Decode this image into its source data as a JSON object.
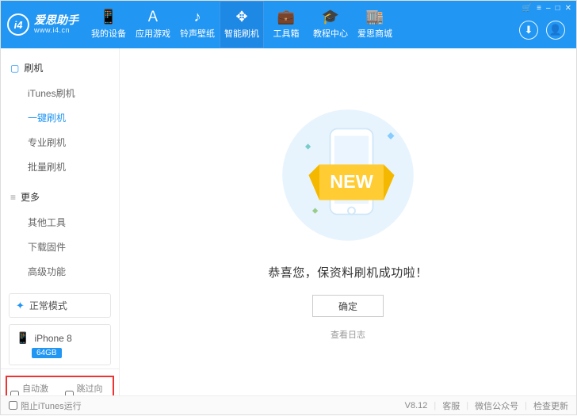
{
  "brand": {
    "logo": "i4",
    "title": "爱思助手",
    "subtitle": "www.i4.cn"
  },
  "titlebar": {
    "btn_cart": "🛒",
    "btn_menu": "≡",
    "btn_min": "–",
    "btn_max": "□",
    "btn_close": "✕"
  },
  "nav": [
    {
      "icon": "📱",
      "label": "我的设备"
    },
    {
      "icon": "Ａ",
      "label": "应用游戏"
    },
    {
      "icon": "♪",
      "label": "铃声壁纸"
    },
    {
      "icon": "✥",
      "label": "智能刷机",
      "active": true
    },
    {
      "icon": "💼",
      "label": "工具箱"
    },
    {
      "icon": "🎓",
      "label": "教程中心"
    },
    {
      "icon": "🏬",
      "label": "爱思商城"
    }
  ],
  "topright": {
    "download_icon": "⬇",
    "user_icon": "👤"
  },
  "sidebar": {
    "sections": [
      {
        "key": "flash",
        "icon": "▢",
        "title": "刷机",
        "items": [
          {
            "label": "iTunes刷机"
          },
          {
            "label": "一键刷机",
            "active": true
          },
          {
            "label": "专业刷机"
          },
          {
            "label": "批量刷机"
          }
        ]
      },
      {
        "key": "more",
        "icon": "≡",
        "title": "更多",
        "items": [
          {
            "label": "其他工具"
          },
          {
            "label": "下载固件"
          },
          {
            "label": "高级功能"
          }
        ]
      }
    ],
    "mode": {
      "icon": "✦",
      "label": "正常模式"
    },
    "device": {
      "icon": "📱",
      "name": "iPhone 8",
      "storage": "64GB"
    },
    "footer": {
      "auto_activate": "自动激活",
      "skip_guide": "跳过向导"
    }
  },
  "main": {
    "banner_text": "NEW",
    "success": "恭喜您，保资料刷机成功啦！",
    "ok": "确定",
    "view_log": "查看日志"
  },
  "statusbar": {
    "block_itunes": "阻止iTunes运行",
    "version": "V8.12",
    "support": "客服",
    "wechat": "微信公众号",
    "check_update": "检查更新"
  }
}
